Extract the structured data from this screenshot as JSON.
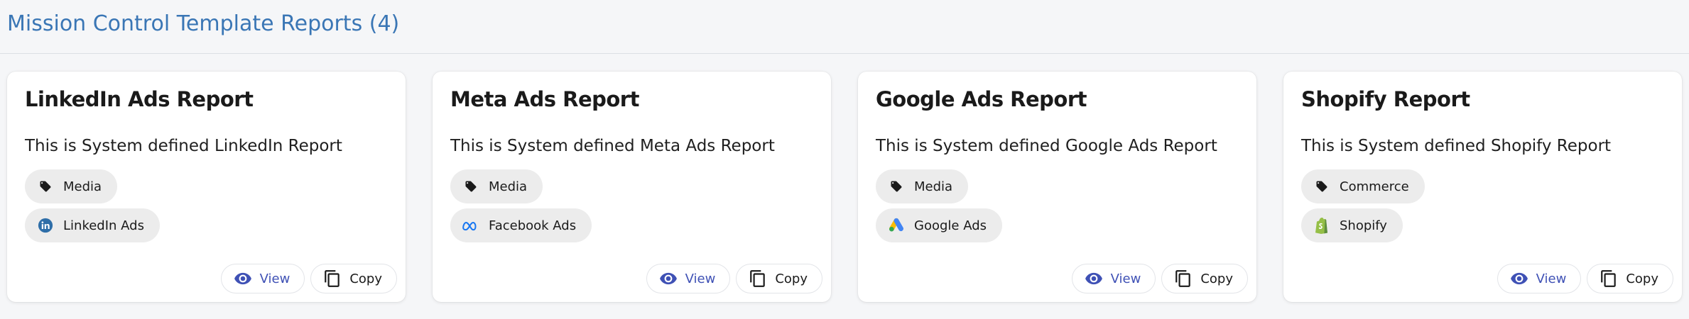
{
  "page": {
    "title": "Mission Control Template Reports (4)"
  },
  "colors": {
    "accent": "#3a76b5",
    "view_button": "#3f51b5",
    "chip_background": "#ececec"
  },
  "cards": [
    {
      "title": "LinkedIn Ads Report",
      "description": "This is System defined LinkedIn Report",
      "category": {
        "label": "Media",
        "icon": "tag-icon"
      },
      "source": {
        "label": "LinkedIn Ads",
        "icon": "linkedin-icon"
      },
      "view_label": "View",
      "copy_label": "Copy"
    },
    {
      "title": "Meta Ads Report",
      "description": "This is System defined Meta Ads Report",
      "category": {
        "label": "Media",
        "icon": "tag-icon"
      },
      "source": {
        "label": "Facebook Ads",
        "icon": "meta-icon"
      },
      "view_label": "View",
      "copy_label": "Copy"
    },
    {
      "title": "Google Ads Report",
      "description": "This is System defined Google Ads Report",
      "category": {
        "label": "Media",
        "icon": "tag-icon"
      },
      "source": {
        "label": "Google Ads",
        "icon": "google-ads-icon"
      },
      "view_label": "View",
      "copy_label": "Copy"
    },
    {
      "title": "Shopify Report",
      "description": "This is System defined Shopify Report",
      "category": {
        "label": "Commerce",
        "icon": "tag-icon"
      },
      "source": {
        "label": "Shopify",
        "icon": "shopify-icon"
      },
      "view_label": "View",
      "copy_label": "Copy"
    }
  ]
}
